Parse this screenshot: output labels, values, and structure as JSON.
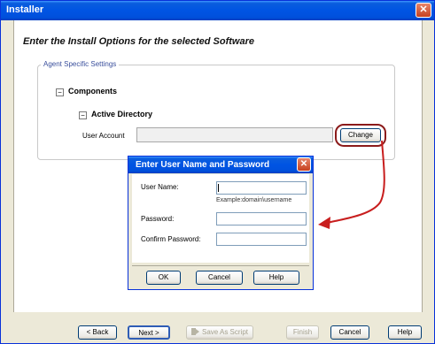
{
  "window": {
    "title": "Installer",
    "close_glyph": "✕"
  },
  "heading": "Enter the Install Options for the selected Software",
  "group": {
    "legend": "Agent Specific Settings",
    "components_label": "Components",
    "active_directory_label": "Active Directory",
    "collapse_glyph": "−",
    "user_account_label": "User Account",
    "user_account_value": "",
    "change_label": "Change"
  },
  "dialog": {
    "title": "Enter User Name and Password",
    "close_glyph": "✕",
    "username_label": "User Name:",
    "username_value": "",
    "username_hint": "Example:domain\\username",
    "password_label": "Password:",
    "password_value": "",
    "confirm_label": "Confirm Password:",
    "confirm_value": "",
    "ok_label": "OK",
    "cancel_label": "Cancel",
    "help_label": "Help"
  },
  "footer": {
    "back_label": "< Back",
    "next_label": "Next >",
    "save_script_label": "Save As Script",
    "save_script_icon": "script-arrow-icon",
    "finish_label": "Finish",
    "cancel_label": "Cancel",
    "help_label": "Help"
  },
  "colors": {
    "title_bar": "#0054e3",
    "annotation": "#c81e1e",
    "highlight_ring": "#8b1a1a",
    "legend_text": "#3a4f9c"
  }
}
